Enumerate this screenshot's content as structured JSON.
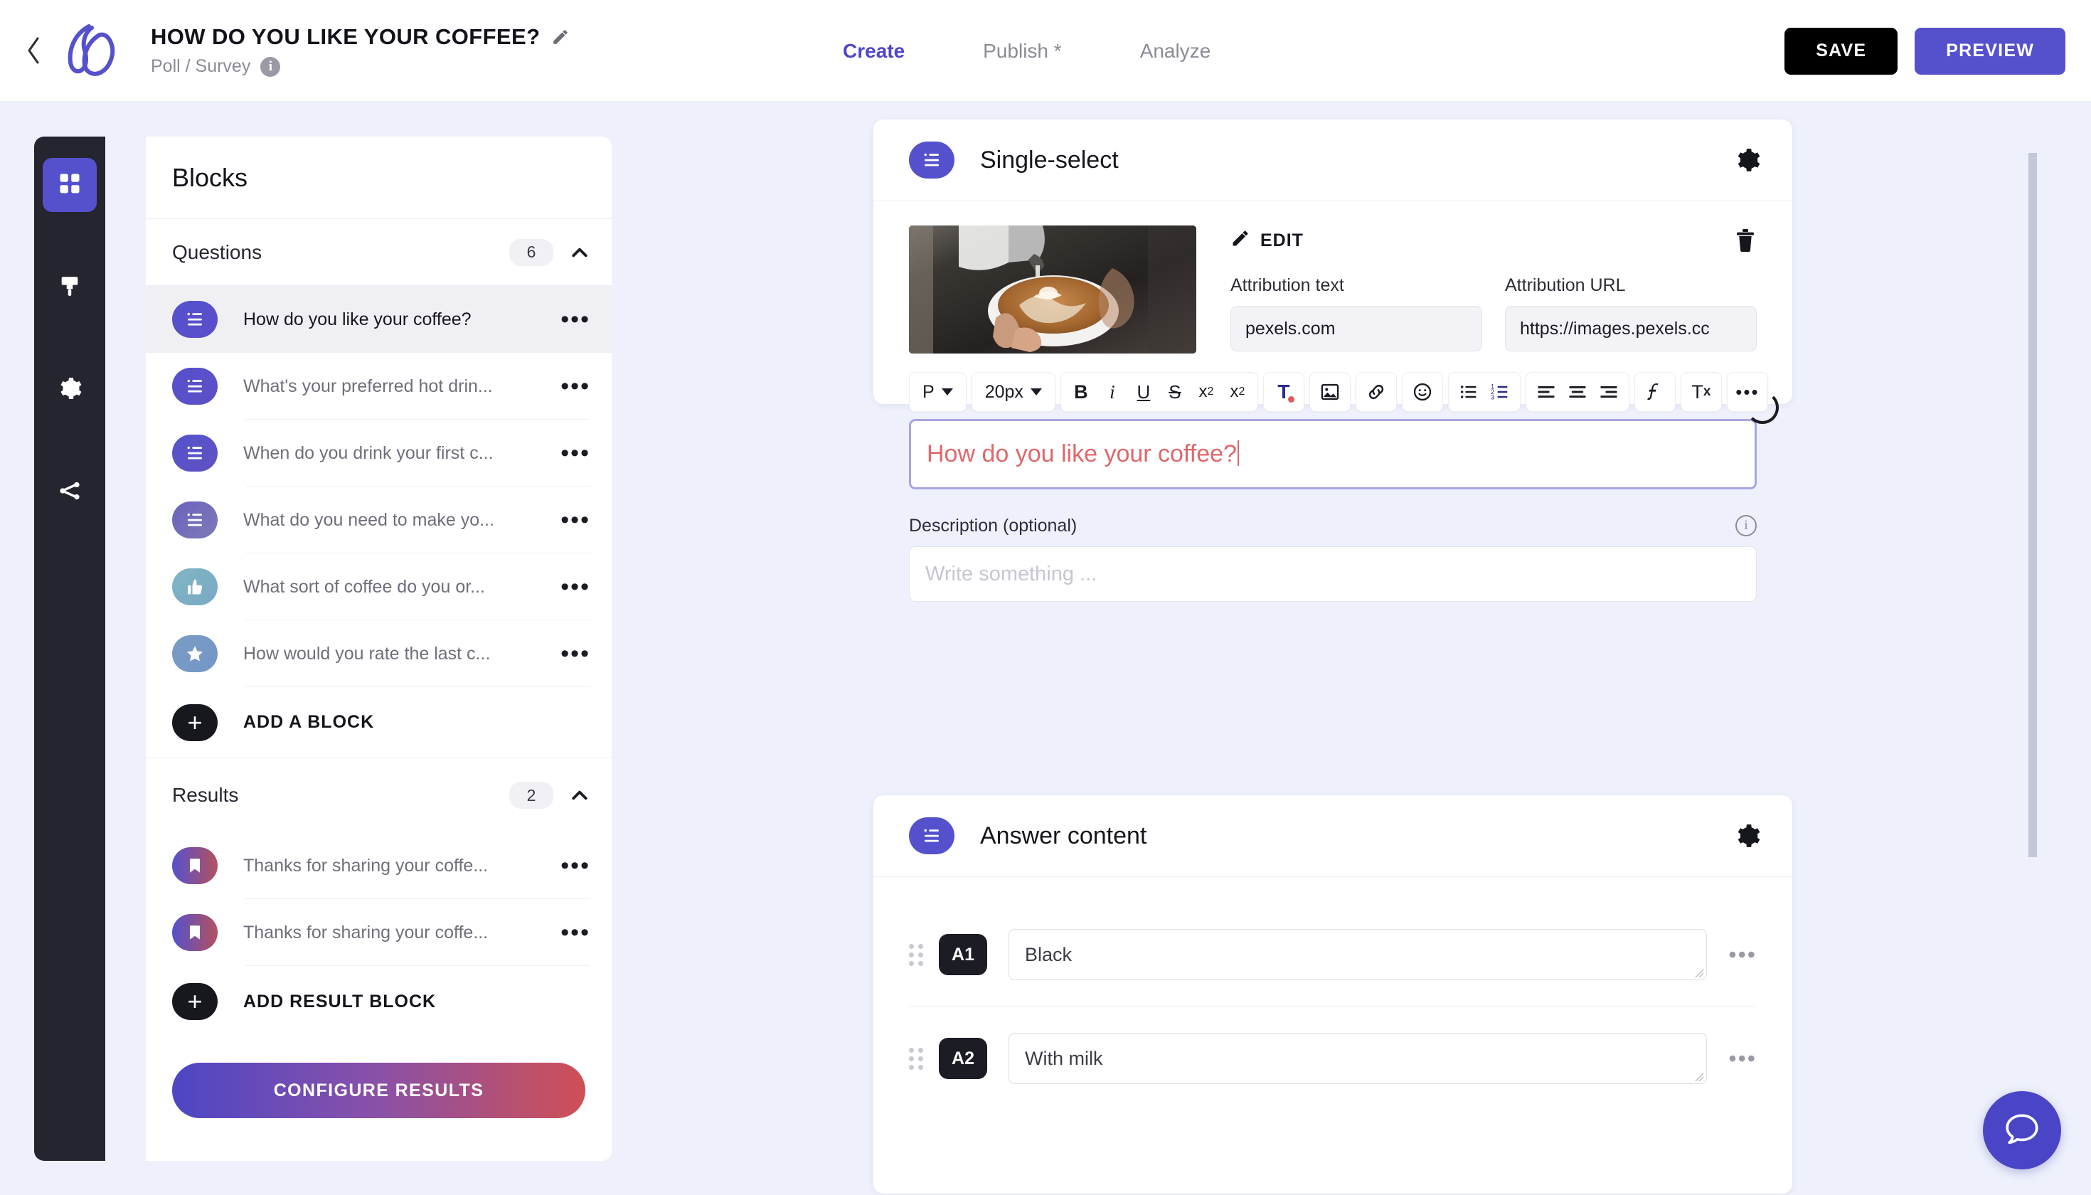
{
  "topbar": {
    "back_icon": "chevron-left-icon",
    "logo_icon": "app-logo-icon",
    "project_title": "HOW DO YOU LIKE YOUR COFFEE?",
    "edit_title_icon": "pencil-icon",
    "project_subtitle": "Poll / Survey",
    "info_icon": "info-icon",
    "tabs": [
      {
        "label": "Create",
        "active": true
      },
      {
        "label": "Publish *",
        "active": false
      },
      {
        "label": "Analyze",
        "active": false
      }
    ],
    "save_label": "SAVE",
    "preview_label": "PREVIEW"
  },
  "rail": {
    "items": [
      {
        "icon": "grid-blocks-icon",
        "active": true
      },
      {
        "icon": "paintbrush-icon",
        "active": false
      },
      {
        "icon": "gear-icon",
        "active": false
      },
      {
        "icon": "share-branch-icon",
        "active": false
      }
    ]
  },
  "blocks_panel": {
    "heading": "Blocks",
    "questions_section": {
      "title": "Questions",
      "count": "6",
      "collapse_icon": "chevron-up-icon",
      "items": [
        {
          "label": "How do you like your coffee?",
          "icon": "list-icon",
          "selected": true
        },
        {
          "label": "What's your preferred hot drin...",
          "icon": "list-icon",
          "selected": false
        },
        {
          "label": "When do you drink your first c...",
          "icon": "list-icon",
          "selected": false
        },
        {
          "label": "What do you need to make yo...",
          "icon": "list-icon",
          "selected": false
        },
        {
          "label": "What sort of coffee do you or...",
          "icon": "thumbs-up-icon",
          "selected": false
        },
        {
          "label": "How would you rate the last c...",
          "icon": "star-icon",
          "selected": false
        }
      ],
      "add_label": "ADD A BLOCK"
    },
    "results_section": {
      "title": "Results",
      "count": "2",
      "collapse_icon": "chevron-up-icon",
      "items": [
        {
          "label": "Thanks for sharing your coffe...",
          "icon": "bookmark-icon"
        },
        {
          "label": "Thanks for sharing your coffe...",
          "icon": "bookmark-icon"
        }
      ],
      "add_label": "ADD RESULT BLOCK"
    },
    "configure_label": "CONFIGURE RESULTS"
  },
  "single_select_card": {
    "icon": "list-icon",
    "title": "Single-select",
    "settings_icon": "gear-icon",
    "thumbnail_alt": "coffee-latte-art-photo",
    "edit_label": "EDIT",
    "edit_icon": "pencil-icon",
    "delete_icon": "trash-icon",
    "attribution_text_label": "Attribution text",
    "attribution_text_value": "pexels.com",
    "attribution_url_label": "Attribution URL",
    "attribution_url_value": "https://images.pexels.cc",
    "toolbar": {
      "paragraph_style": "P",
      "font_size": "20px",
      "bold": "B",
      "italic": "i",
      "underline": "U",
      "strikethrough": "S",
      "superscript_base": "x",
      "superscript_exp": "2",
      "subscript_base": "x",
      "subscript_exp": "2",
      "text_color": "T",
      "image_icon": "image-icon",
      "link_icon": "link-icon",
      "emoji_icon": "emoji-icon",
      "bullet_list_icon": "bullet-list-icon",
      "numbered_list_icon": "numbered-list-icon",
      "align_left_icon": "align-left-icon",
      "align_center_icon": "align-center-icon",
      "align_right_icon": "align-right-icon",
      "variable_icon": "variable-f-icon",
      "clear_format_label": "T",
      "clear_format_x": "x",
      "more_label": "•••"
    },
    "question_text": "How do you like your coffee?",
    "question_text_color": "#e0676b",
    "description_label": "Description (optional)",
    "description_info_icon": "info-icon",
    "description_placeholder": "Write something ..."
  },
  "answer_card": {
    "icon": "list-icon",
    "title": "Answer content",
    "settings_icon": "gear-icon",
    "rows": [
      {
        "tag": "A1",
        "value": "Black",
        "drag_icon": "drag-handle-icon",
        "menu_icon": "more-dots-icon"
      },
      {
        "tag": "A2",
        "value": "With milk",
        "drag_icon": "drag-handle-icon",
        "menu_icon": "more-dots-icon"
      }
    ]
  },
  "chat": {
    "icon": "chat-bubble-icon"
  },
  "colors": {
    "accent": "#5551cd",
    "page_bg": "#eef1fb",
    "rail_bg": "#25252f",
    "question_red": "#e0676b",
    "gradient_start": "#4d46c4",
    "gradient_end": "#cf4f55"
  }
}
